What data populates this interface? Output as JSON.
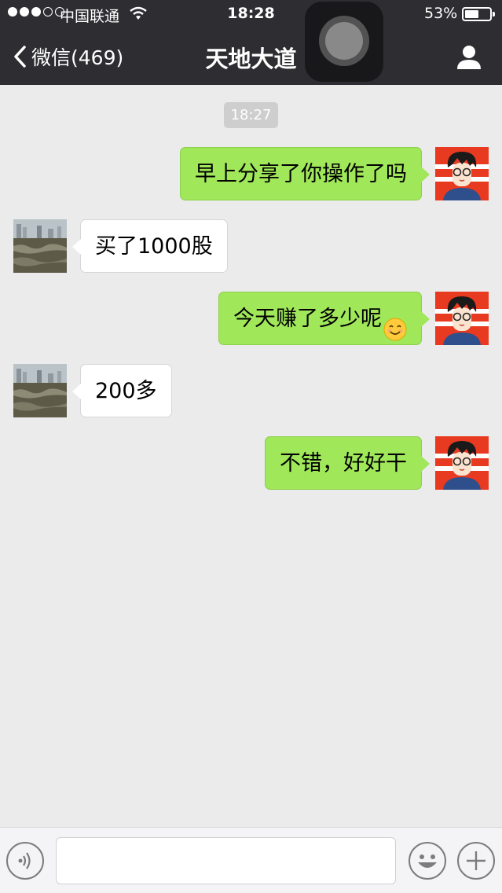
{
  "status_bar": {
    "carrier": "中国联通",
    "time": "18:28",
    "battery": "53%",
    "battery_level": 0.53,
    "signal_bars_filled": 3,
    "signal_bars_total": 5
  },
  "nav": {
    "back_label": "微信(469)",
    "title": "天地大道",
    "back_icon": "chevron-left-icon",
    "profile_icon": "person-icon"
  },
  "chat": {
    "time_chip": "18:27",
    "messages": [
      {
        "side": "me",
        "text": "早上分享了你操作了吗"
      },
      {
        "side": "them",
        "text": "买了1000股"
      },
      {
        "side": "me",
        "text": "今天赚了多少呢",
        "emoji": "smiling-face-emoji"
      },
      {
        "side": "them",
        "text": "200多"
      },
      {
        "side": "me",
        "text": "不错，好好干"
      }
    ]
  },
  "input_bar": {
    "voice_icon": "voice-icon",
    "emoji_icon": "emoji-face-icon",
    "plus_icon": "plus-icon",
    "text_value": ""
  },
  "colors": {
    "nav_bg": "#2e2e32",
    "chat_bg": "#ebebeb",
    "my_bubble": "#a0e75a",
    "their_bubble": "#ffffff"
  }
}
